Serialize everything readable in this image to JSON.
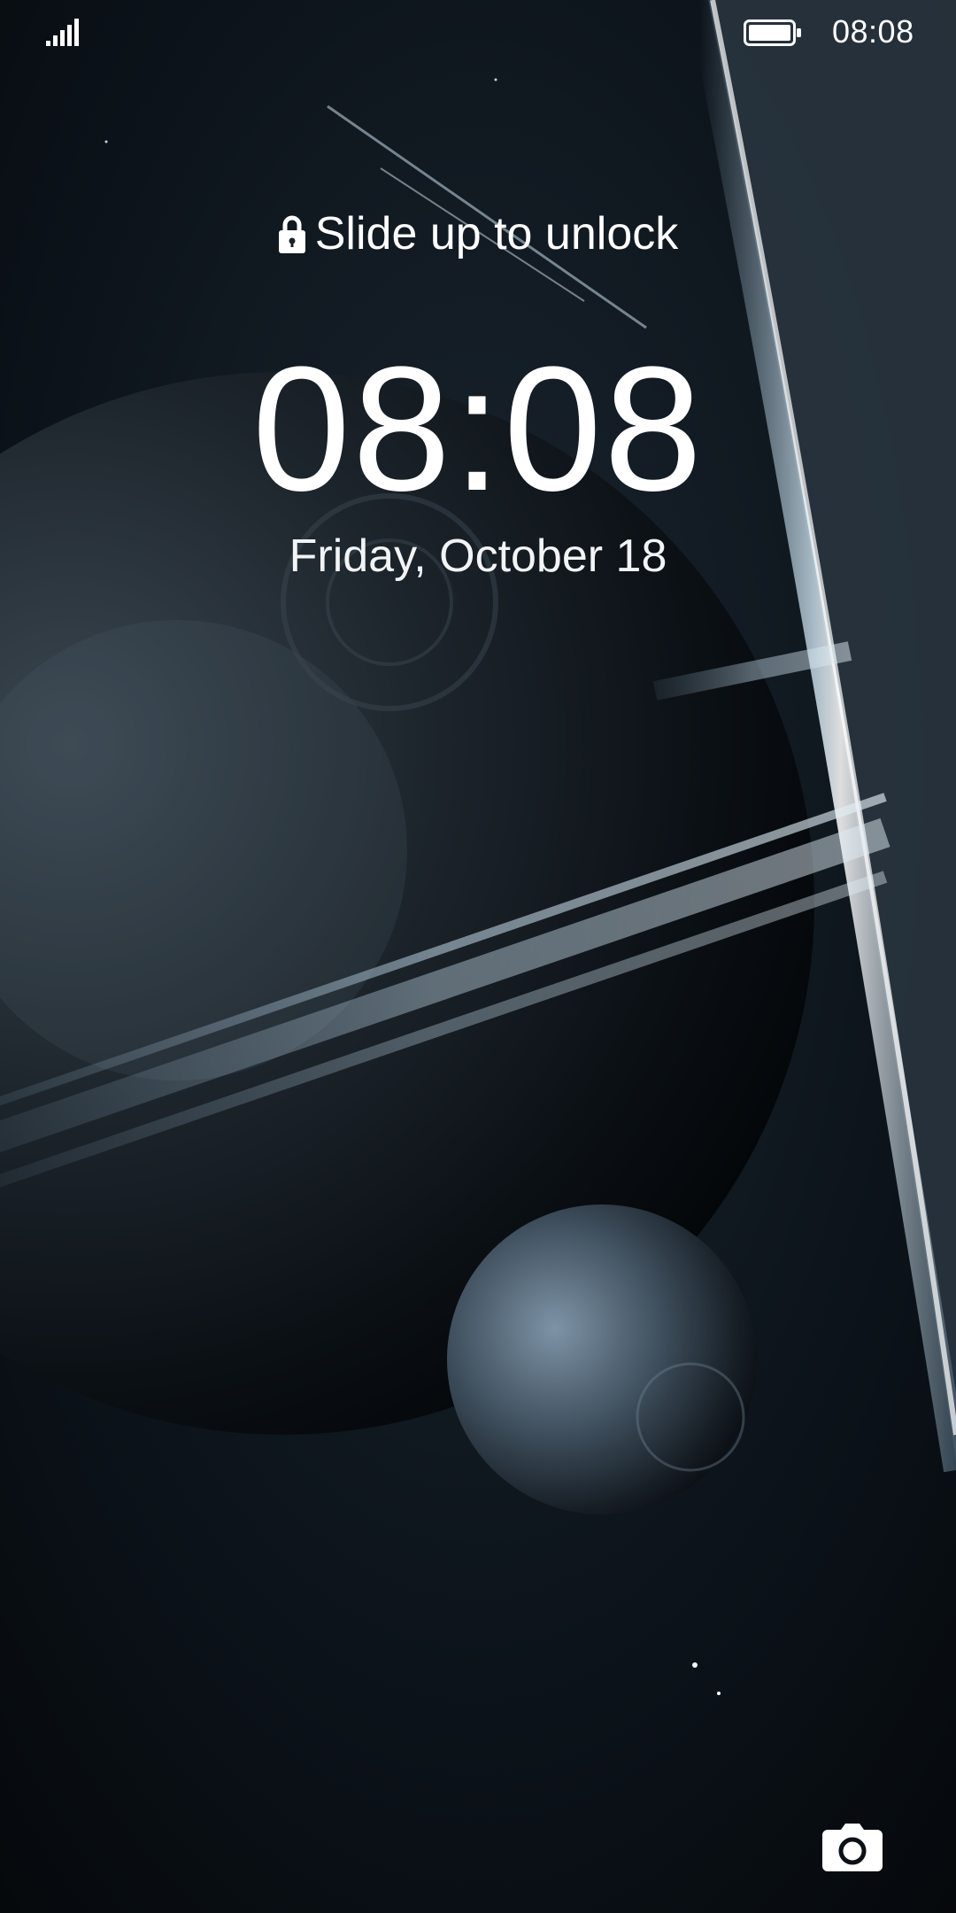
{
  "status_bar": {
    "signal_icon": "signal-bars-icon",
    "battery_icon": "battery-full-icon",
    "time": "08:08"
  },
  "lock_screen": {
    "lock_icon": "lock-icon",
    "unlock_hint": "Slide up to unlock",
    "clock": "08:08",
    "date": "Friday, October 18"
  },
  "shortcuts": {
    "camera_icon": "camera-icon"
  },
  "colors": {
    "text": "#ffffff",
    "background": "#06090d"
  }
}
